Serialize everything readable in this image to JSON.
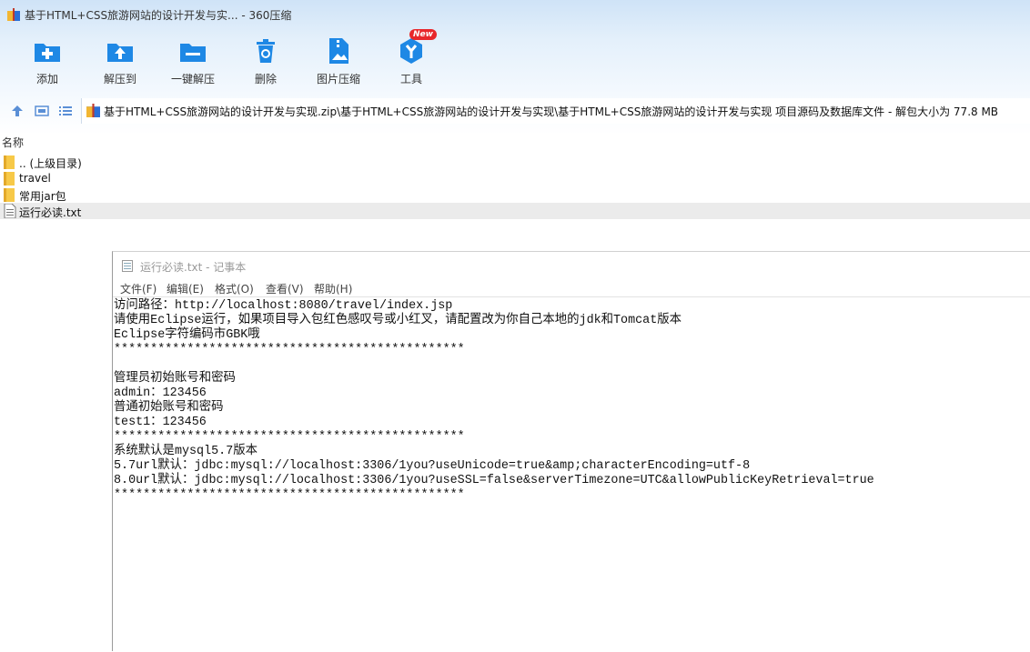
{
  "window": {
    "title": "基于HTML+CSS旅游网站的设计开发与实... - 360压缩"
  },
  "toolbar": {
    "buttons": [
      {
        "label": "添加",
        "icon": "add-folder-icon"
      },
      {
        "label": "解压到",
        "icon": "extract-to-icon"
      },
      {
        "label": "一键解压",
        "icon": "one-click-extract-icon"
      },
      {
        "label": "删除",
        "icon": "trash-icon"
      },
      {
        "label": "图片压缩",
        "icon": "image-compress-icon"
      },
      {
        "label": "工具",
        "icon": "tools-icon",
        "badge": "New"
      }
    ]
  },
  "nav": {
    "address": "基于HTML+CSS旅游网站的设计开发与实现.zip\\基于HTML+CSS旅游网站的设计开发与实现\\基于HTML+CSS旅游网站的设计开发与实现 项目源码及数据库文件 - 解包大小为 77.8 MB"
  },
  "file_list": {
    "column_name": "名称",
    "items": [
      {
        "name": ".. (上级目录)",
        "type": "folder"
      },
      {
        "name": "travel",
        "type": "folder"
      },
      {
        "name": "常用jar包",
        "type": "folder"
      },
      {
        "name": "运行必读.txt",
        "type": "text-file",
        "selected": true
      }
    ]
  },
  "notepad": {
    "title": "运行必读.txt - 记事本",
    "menu": [
      "文件(F)",
      "编辑(E)",
      "格式(O)",
      "查看(V)",
      "帮助(H)"
    ],
    "lines": [
      "访问路径：http://localhost:8080/travel/index.jsp",
      "请使用Eclipse运行，如果项目导入包红色感叹号或小红叉，请配置改为你自己本地的jdk和Tomcat版本",
      "Eclipse字符编码市GBK哦",
      "************************************************",
      "",
      "管理员初始账号和密码",
      "admin：123456",
      "普通初始账号和密码",
      "test1：123456",
      "************************************************",
      "系统默认是mysql5.7版本",
      "5.7url默认：jdbc:mysql://localhost:3306/1you?useUnicode=true&amp;characterEncoding=utf-8",
      "8.0url默认：jdbc:mysql://localhost:3306/1you?useSSL=false&serverTimezone=UTC&allowPublicKeyRetrieval=true",
      "************************************************"
    ]
  },
  "colors": {
    "toolbar_icon_blue": "#1e88e5",
    "folder_yellow": "#f7c948",
    "badge_red": "#e8272b",
    "header_gradient_top": "#cfe3f7"
  }
}
